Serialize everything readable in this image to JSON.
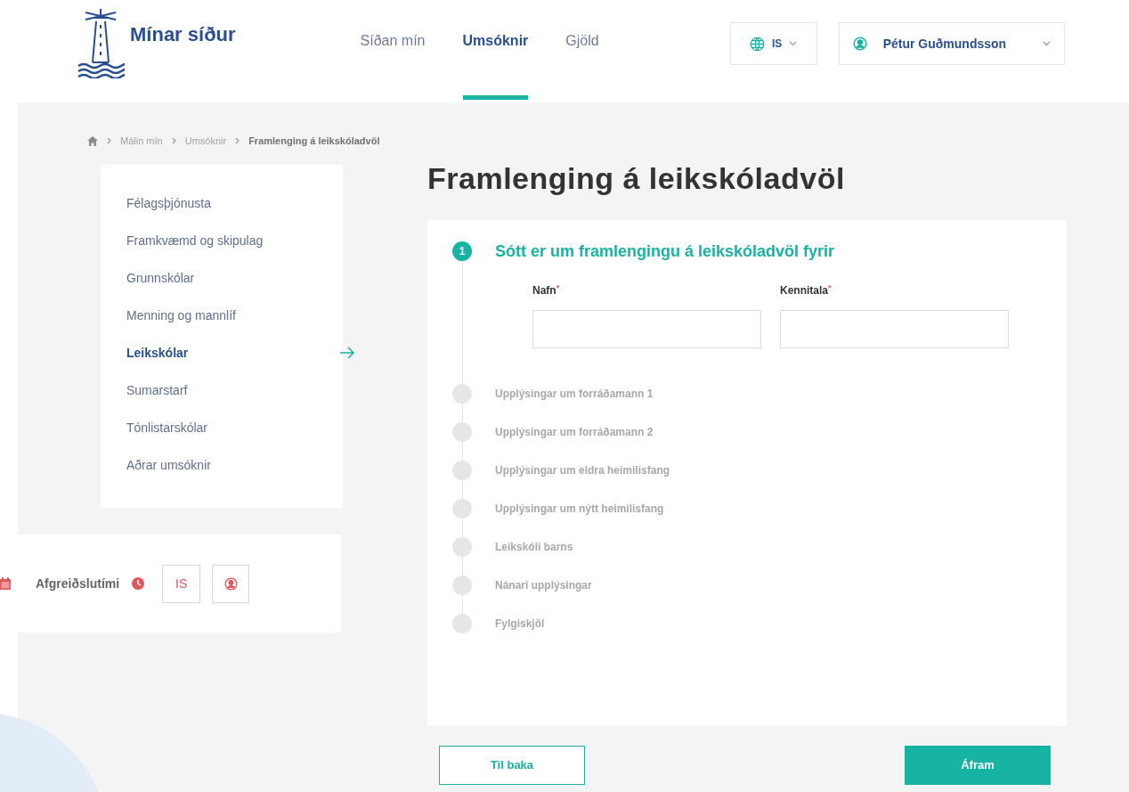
{
  "header": {
    "logo_text": "Mínar síður",
    "nav": [
      {
        "label": "Síðan mín",
        "selected": false
      },
      {
        "label": "Umsóknir",
        "selected": true
      },
      {
        "label": "Gjöld",
        "selected": false
      }
    ],
    "language": "IS",
    "user": "Pétur Guðmundsson"
  },
  "breadcrumb": [
    "Málin mín",
    "Umsóknir",
    "Framlenging á leikskóladvöl"
  ],
  "sidebar": {
    "items": [
      {
        "label": "Félagsþjónusta",
        "selected": false
      },
      {
        "label": "Framkvæmd og skipulag",
        "selected": false
      },
      {
        "label": "Grunnskólar",
        "selected": false
      },
      {
        "label": "Menning og mannlíf",
        "selected": false
      },
      {
        "label": "Leikskólar",
        "selected": true
      },
      {
        "label": "Sumarstarf",
        "selected": false
      },
      {
        "label": "Tónlistarskólar",
        "selected": false
      },
      {
        "label": "Aðrar umsóknir",
        "selected": false
      }
    ]
  },
  "footer_strip": {
    "label": "Afgreiðslutími",
    "language_button": "IS"
  },
  "page_title": "Framlenging á leikskóladvöl",
  "steps": [
    {
      "number": "1",
      "title": "Sótt er um framlengingu á leikskóladvöl fyrir",
      "active": true,
      "fields": [
        {
          "label": "Nafn",
          "required": true,
          "required_mark": "*"
        },
        {
          "label": "Kennitala",
          "required": true,
          "required_mark": "*"
        }
      ]
    },
    {
      "title": "Upplýsingar um forráðamann 1",
      "active": false
    },
    {
      "title": "Upplýsingar um forráðamann 2",
      "active": false
    },
    {
      "title": "Upplýsingar um eldra heimilisfang",
      "active": false
    },
    {
      "title": "Upplýsingar um nýtt heimilisfang",
      "active": false
    },
    {
      "title": "Leikskóli barns",
      "active": false
    },
    {
      "title": "Nánari upplýsingar",
      "active": false
    },
    {
      "title": "Fylgiskjöl",
      "active": false
    }
  ],
  "buttons": {
    "back": "Til baka",
    "next": "Áfram"
  }
}
